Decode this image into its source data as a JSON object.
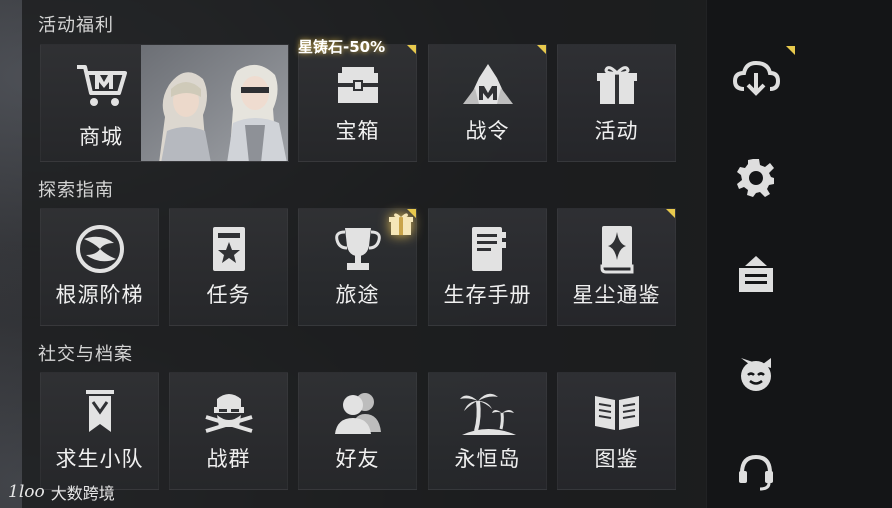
{
  "sections": [
    {
      "title": "活动福利",
      "tiles": [
        {
          "label": "商城",
          "icon": "shop-cart-icon"
        },
        {
          "label": "宝箱",
          "icon": "treasure-chest-icon"
        },
        {
          "label": "战令",
          "icon": "battle-pass-icon"
        },
        {
          "label": "活动",
          "icon": "gift-box-icon"
        }
      ]
    },
    {
      "title": "探索指南",
      "tiles": [
        {
          "label": "根源阶梯",
          "icon": "origin-ladder-icon"
        },
        {
          "label": "任务",
          "icon": "quest-card-icon"
        },
        {
          "label": "旅途",
          "icon": "trophy-icon"
        },
        {
          "label": "生存手册",
          "icon": "handbook-icon"
        },
        {
          "label": "星尘通鉴",
          "icon": "stardust-book-icon"
        }
      ]
    },
    {
      "title": "社交与档案",
      "tiles": [
        {
          "label": "求生小队",
          "icon": "squad-banner-icon"
        },
        {
          "label": "战群",
          "icon": "war-group-icon"
        },
        {
          "label": "好友",
          "icon": "friends-icon"
        },
        {
          "label": "永恒岛",
          "icon": "palm-island-icon"
        },
        {
          "label": "图鉴",
          "icon": "open-book-icon"
        }
      ]
    }
  ],
  "promo_badge": "星铸石-50%",
  "sidebar": [
    "cloud-download-icon",
    "settings-gear-icon",
    "mail-inbox-icon",
    "mascot-face-icon",
    "headset-support-icon"
  ],
  "watermark": {
    "logo": "1loo",
    "text": "大数跨境"
  },
  "colors": {
    "accent": "#e7c94d",
    "tile_bg": "#303134",
    "text": "#f0f0f0",
    "icon": "#e2e2e2"
  }
}
